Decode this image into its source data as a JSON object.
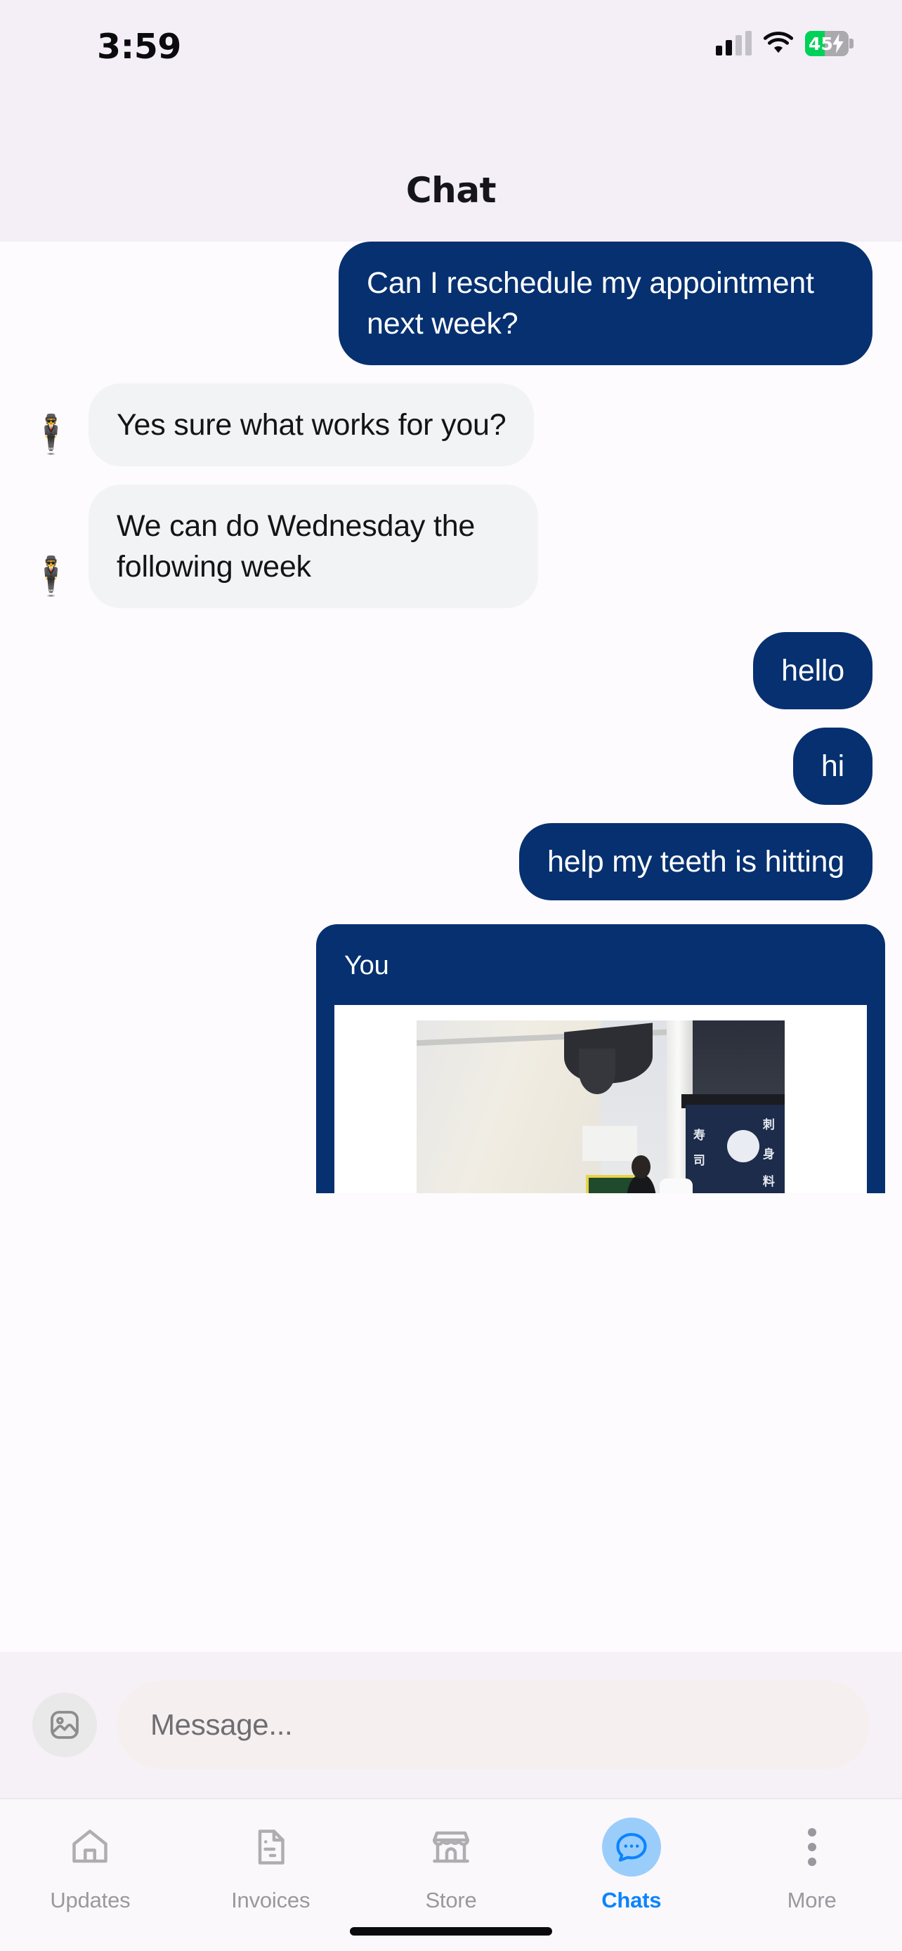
{
  "status_bar": {
    "time": "3:59",
    "battery_percent": "45",
    "battery_level": 45,
    "battery_charging": true,
    "battery_color": "#00D158",
    "signal_bars_filled": 2,
    "signal_bars_total": 4,
    "wifi_icon": "wifi-icon"
  },
  "header": {
    "title": "Chat",
    "background": "#F4EEF7"
  },
  "theme": {
    "outgoing_bubble": "#063070",
    "incoming_bubble": "#F1F3F4",
    "accent_blue": "#0A84FF",
    "active_tab_circle": "#9BCDFB",
    "page_background": "#FDFBFD"
  },
  "conversation": {
    "messages": [
      {
        "id": "m1",
        "direction": "outgoing",
        "text": "Can I reschedule my appointment next week?",
        "avatar": ""
      },
      {
        "id": "m2",
        "direction": "incoming",
        "text": "Yes sure what works for you?",
        "avatar": "🕴️"
      },
      {
        "id": "m3",
        "direction": "incoming",
        "text": "We can do Wednesday the following week",
        "avatar": "🕴️"
      },
      {
        "id": "m4",
        "direction": "outgoing",
        "text": "hello",
        "avatar": ""
      },
      {
        "id": "m5",
        "direction": "outgoing",
        "text": "hi",
        "avatar": ""
      },
      {
        "id": "m6",
        "direction": "outgoing",
        "text": "help my teeth is hitting",
        "avatar": ""
      }
    ],
    "image_card": {
      "sender_label": "You",
      "attachment_alt": "Interior photo of a Japanese sushi restaurant with wooden table, chairs, shoji screen and counter"
    }
  },
  "composer": {
    "attach_icon": "image-icon",
    "placeholder": "Message..."
  },
  "tabbar": {
    "items": [
      {
        "id": "updates",
        "label": "Updates",
        "icon": "home-icon",
        "active": false
      },
      {
        "id": "invoices",
        "label": "Invoices",
        "icon": "document-icon",
        "active": false
      },
      {
        "id": "store",
        "label": "Store",
        "icon": "store-icon",
        "active": false
      },
      {
        "id": "chats",
        "label": "Chats",
        "icon": "chat-bubble-icon",
        "active": true
      },
      {
        "id": "more",
        "label": "More",
        "icon": "more-vertical-icon",
        "active": false
      }
    ]
  }
}
